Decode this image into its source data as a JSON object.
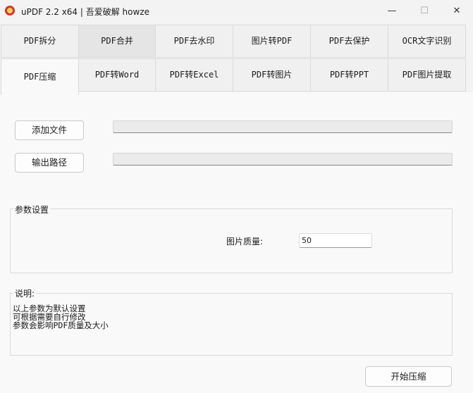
{
  "window": {
    "title": "uPDF 2.2 x64 | 吾爱破解 howze",
    "minimize": "—",
    "maximize": "☐",
    "close": "✕"
  },
  "tabs_row1": [
    "PDF拆分",
    "PDF合并",
    "PDF去水印",
    "图片转PDF",
    "PDF去保护",
    "OCR文字识别"
  ],
  "tabs_row2": [
    "PDF压缩",
    "PDF转Word",
    "PDF转Excel",
    "PDF转图片",
    "PDF转PPT",
    "PDF图片提取"
  ],
  "active_tab": "PDF压缩",
  "main": {
    "add_file_button": "添加文件",
    "output_path_button": "输出路径",
    "file_path_value": "",
    "output_path_value": "",
    "params_group": "参数设置",
    "image_quality_label": "图片质量:",
    "image_quality_value": "50",
    "notes_group": "说明:",
    "notes_line1": "以上参数为默认设置",
    "notes_line2": "可根据需要自行修改",
    "notes_line3": "参数会影响PDF质量及大小",
    "start_button": "开始压缩"
  }
}
